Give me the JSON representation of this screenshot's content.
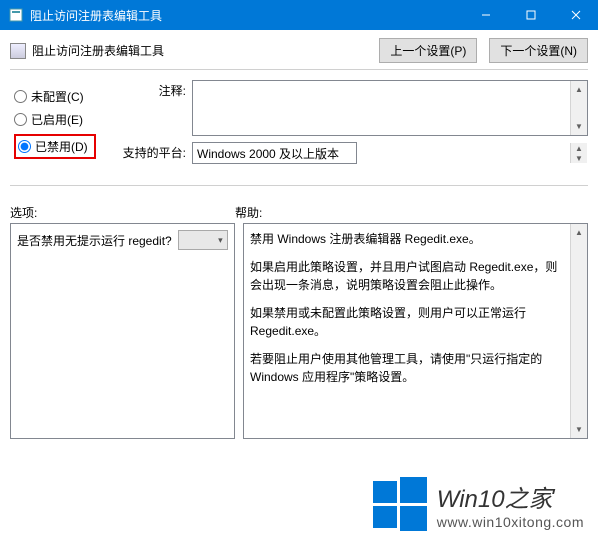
{
  "titlebar": {
    "title": "阻止访问注册表编辑工具"
  },
  "header": {
    "policy_title": "阻止访问注册表编辑工具",
    "prev_btn": "上一个设置(P)",
    "next_btn": "下一个设置(N)"
  },
  "radios": {
    "not_configured": "未配置(C)",
    "enabled": "已启用(E)",
    "disabled": "已禁用(D)",
    "selected": "disabled"
  },
  "fields": {
    "comment_label": "注释:",
    "comment_value": "",
    "platform_label": "支持的平台:",
    "platform_value": "Windows 2000 及以上版本"
  },
  "labels": {
    "options": "选项:",
    "help": "帮助:"
  },
  "options": {
    "prompt": "是否禁用无提示运行 regedit?",
    "select_value": ""
  },
  "help": {
    "p1": "禁用 Windows 注册表编辑器 Regedit.exe。",
    "p2": "如果启用此策略设置，并且用户试图启动 Regedit.exe，则会出现一条消息，说明策略设置会阻止此操作。",
    "p3": "如果禁用或未配置此策略设置，则用户可以正常运行 Regedit.exe。",
    "p4": "若要阻止用户使用其他管理工具，请使用\"只运行指定的 Windows 应用程序\"策略设置。"
  },
  "watermark": {
    "title": "Win10之家",
    "url": "www.win10xitong.com"
  }
}
